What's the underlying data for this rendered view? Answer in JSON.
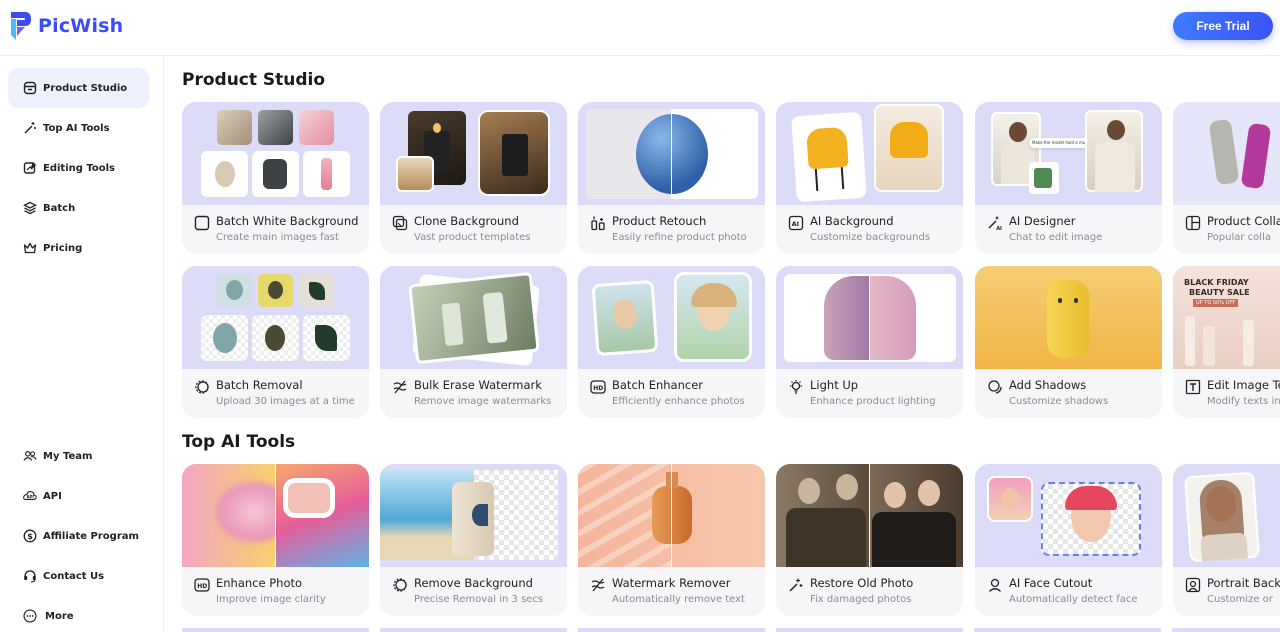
{
  "brand": {
    "name": "PicWish",
    "accent": "#3b4cf6"
  },
  "header": {
    "trial_label": "Free Trial"
  },
  "sidebar": {
    "top": [
      {
        "label": "Product Studio",
        "icon": "box-icon",
        "active": true
      },
      {
        "label": "Top AI Tools",
        "icon": "magic-wand-icon"
      },
      {
        "label": "Editing Tools",
        "icon": "edit-image-icon"
      },
      {
        "label": "Batch",
        "icon": "layers-icon"
      },
      {
        "label": "Pricing",
        "icon": "crown-icon"
      }
    ],
    "bottom": [
      {
        "label": "My Team",
        "icon": "team-icon"
      },
      {
        "label": "API",
        "icon": "api-icon"
      },
      {
        "label": "Affiliate Program",
        "icon": "dollar-icon"
      },
      {
        "label": "Contact Us",
        "icon": "headset-icon"
      },
      {
        "label": "More",
        "icon": "more-icon"
      }
    ]
  },
  "sections": {
    "product_studio": "Product Studio",
    "top_ai_tools": "Top AI Tools"
  },
  "cards_row1": [
    {
      "title": "Batch White Background",
      "sub": "Create main images fast",
      "icon": "square-icon"
    },
    {
      "title": "Clone Background",
      "sub": "Vast product templates",
      "icon": "clone-icon"
    },
    {
      "title": "Product Retouch",
      "sub": "Easily refine product photo",
      "icon": "retouch-icon"
    },
    {
      "title": "AI Background",
      "sub": "Customize backgrounds",
      "icon": "ai-background-icon"
    },
    {
      "title": "AI Designer",
      "sub": "Chat to edit image",
      "icon": "ai-designer-icon"
    },
    {
      "title": "Product Colla",
      "sub": "Popular colla",
      "icon": "collage-icon"
    }
  ],
  "cards_row2": [
    {
      "title": "Batch Removal",
      "sub": "Upload 30 images at a time",
      "icon": "removal-icon"
    },
    {
      "title": "Bulk Erase Watermark",
      "sub": "Remove image watermarks",
      "icon": "watermark-icon"
    },
    {
      "title": "Batch Enhancer",
      "sub": "Efficiently enhance photos",
      "icon": "hd-icon"
    },
    {
      "title": "Light Up",
      "sub": "Enhance product lighting",
      "icon": "bulb-icon"
    },
    {
      "title": "Add Shadows",
      "sub": "Customize shadows",
      "icon": "shadow-icon"
    },
    {
      "title": "Edit Image Te",
      "sub": "Modify texts in",
      "icon": "text-edit-icon"
    }
  ],
  "cards_row3": [
    {
      "title": "Enhance Photo",
      "sub": "Improve image clarity",
      "icon": "hd-icon"
    },
    {
      "title": "Remove Background",
      "sub": "Precise Removal in 3 secs",
      "icon": "removal-icon"
    },
    {
      "title": "Watermark Remover",
      "sub": "Automatically remove text",
      "icon": "watermark-icon"
    },
    {
      "title": "Restore Old Photo",
      "sub": "Fix damaged photos",
      "icon": "sparkle-icon"
    },
    {
      "title": "AI Face Cutout",
      "sub": "Automatically detect face",
      "icon": "face-icon"
    },
    {
      "title": "Portrait Back",
      "sub": "Customize or",
      "icon": "portrait-icon"
    }
  ],
  "thumb_text": {
    "ai_designer_bubble": "Make the model hold a mug",
    "black_friday": "BLACK FRIDAY",
    "beauty_sale": "BEAUTY SALE",
    "up_to": "UP TO 50% OFF"
  }
}
